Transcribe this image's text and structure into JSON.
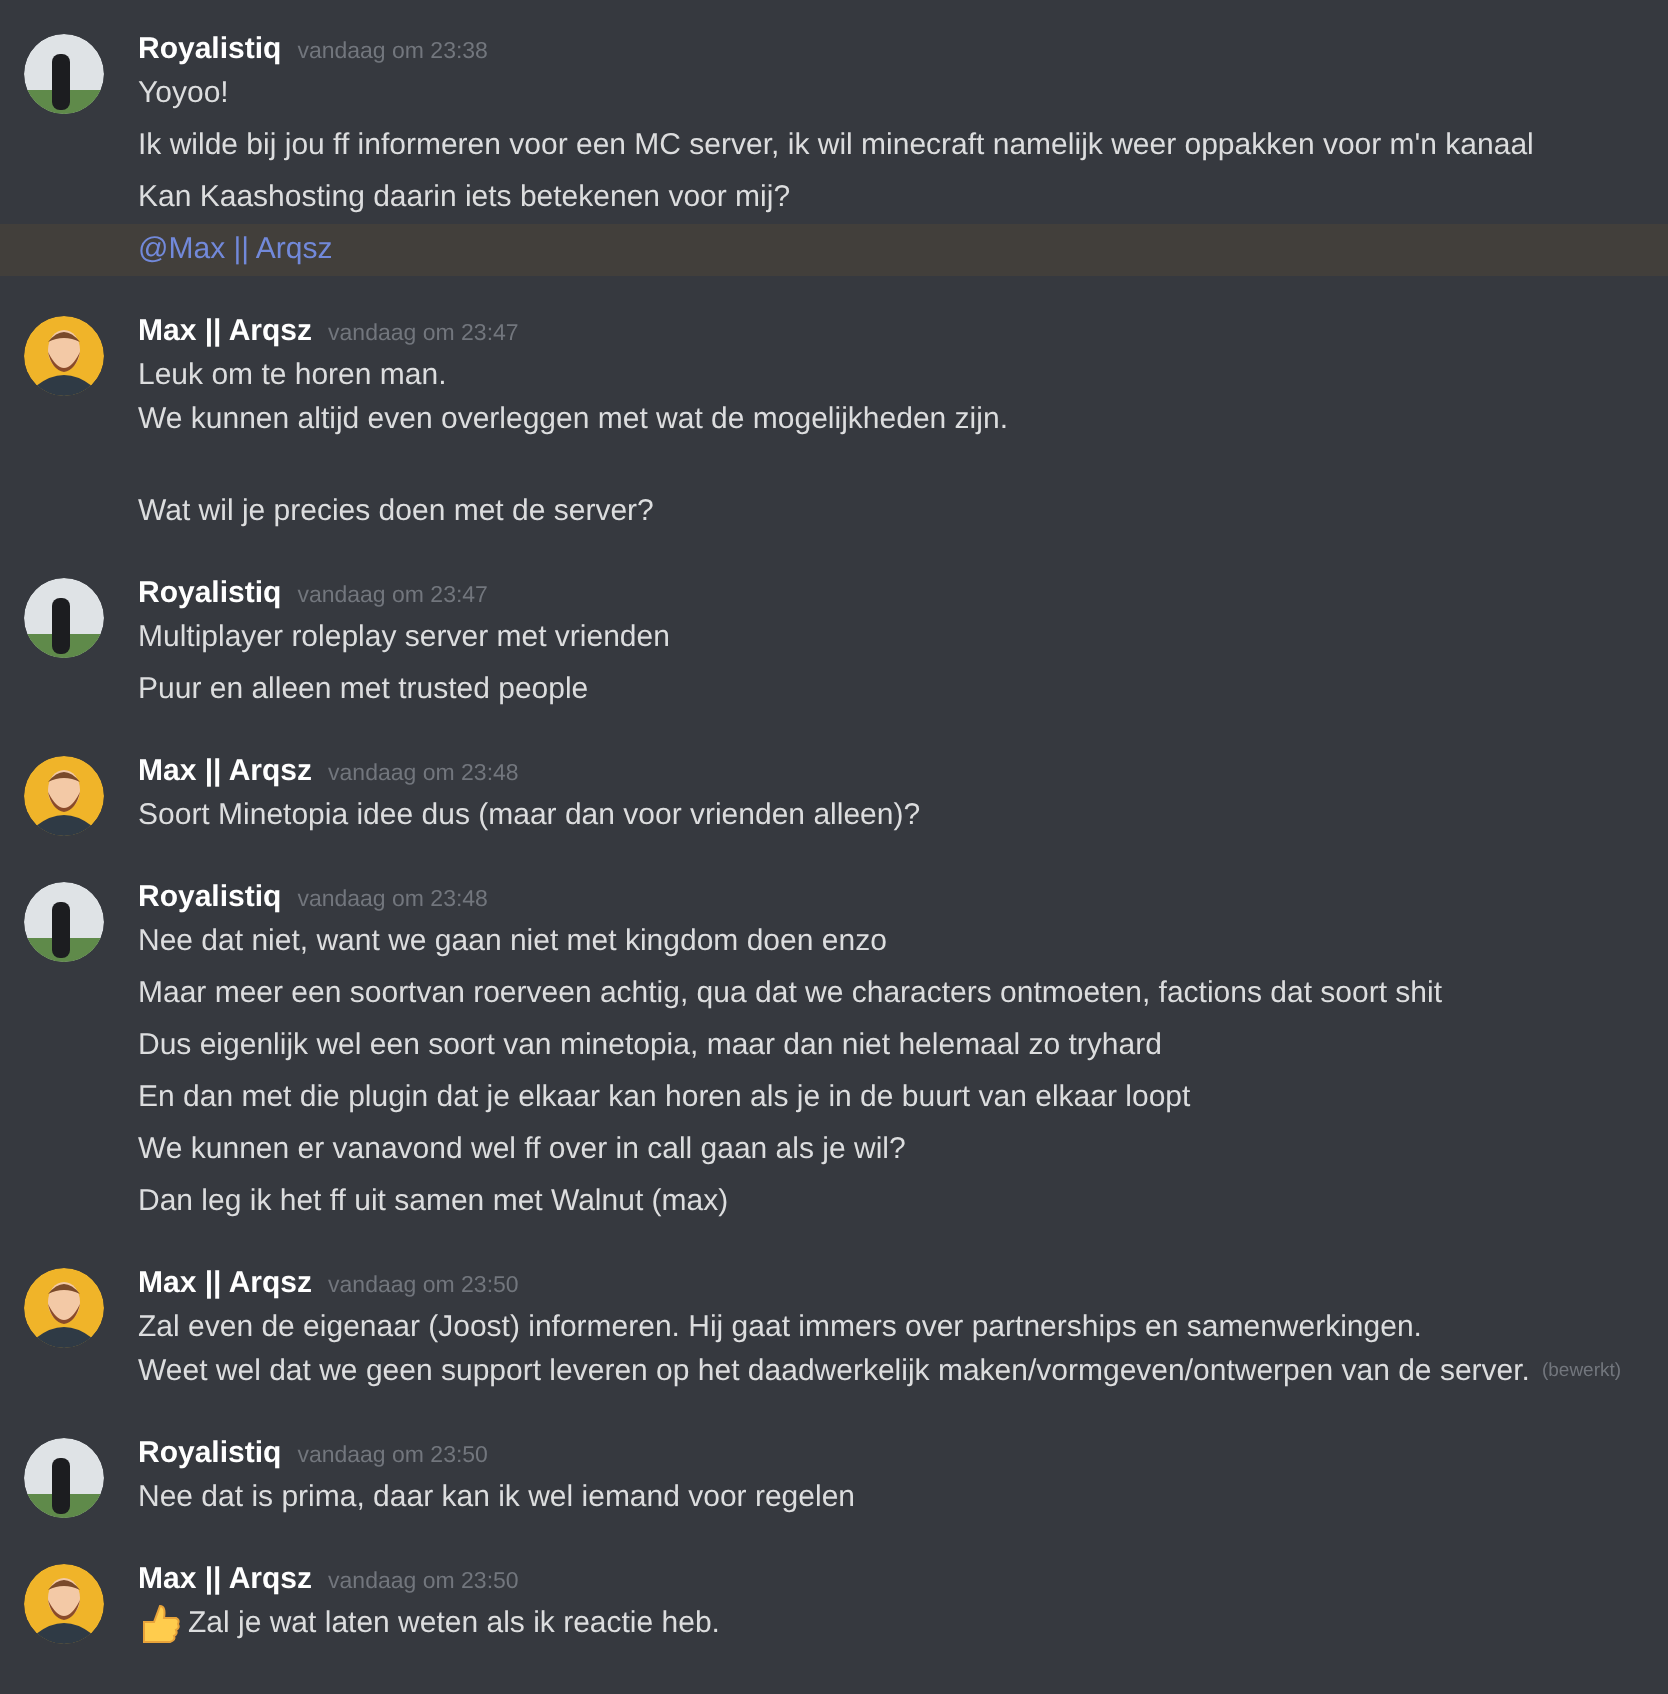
{
  "messages": [
    {
      "author": "Royalistiq",
      "kind": "photo",
      "timestamp": "vandaag om 23:38",
      "messages": [
        {
          "kind": "text",
          "lines": [
            "Yoyoo!"
          ]
        },
        {
          "kind": "text",
          "lines": [
            "Ik wilde bij jou ff informeren voor een MC server, ik wil minecraft namelijk weer oppakken voor m'n kanaal"
          ]
        },
        {
          "kind": "text",
          "lines": [
            "Kan Kaashosting daarin iets betekenen voor mij?"
          ]
        },
        {
          "kind": "mention",
          "lines": [
            "@Max || Arqsz"
          ]
        }
      ]
    },
    {
      "author": "Max || Arqsz",
      "kind": "cartoon",
      "timestamp": "vandaag om 23:47",
      "messages": [
        {
          "kind": "text",
          "lines": [
            "Leuk om te horen man.",
            "We kunnen altijd even overleggen met wat de mogelijkheden zijn."
          ]
        },
        {
          "kind": "paragraph",
          "lines": [
            "Wat wil je precies doen met de server?"
          ]
        }
      ]
    },
    {
      "author": "Royalistiq",
      "kind": "photo",
      "timestamp": "vandaag om 23:47",
      "messages": [
        {
          "kind": "text",
          "lines": [
            "Multiplayer roleplay server met vrienden"
          ]
        },
        {
          "kind": "text",
          "lines": [
            "Puur en alleen met trusted people"
          ]
        }
      ]
    },
    {
      "author": "Max || Arqsz",
      "kind": "cartoon",
      "timestamp": "vandaag om 23:48",
      "messages": [
        {
          "kind": "text",
          "lines": [
            "Soort Minetopia idee dus (maar dan voor vrienden alleen)?"
          ]
        }
      ]
    },
    {
      "author": "Royalistiq",
      "kind": "photo",
      "timestamp": "vandaag om 23:48",
      "messages": [
        {
          "kind": "text",
          "lines": [
            "Nee dat niet, want we gaan niet met kingdom doen enzo"
          ]
        },
        {
          "kind": "text",
          "lines": [
            "Maar meer een soortvan roerveen achtig, qua dat we characters ontmoeten, factions dat soort shit"
          ]
        },
        {
          "kind": "text",
          "lines": [
            "Dus eigenlijk wel een soort van minetopia, maar dan niet helemaal zo tryhard"
          ]
        },
        {
          "kind": "text",
          "lines": [
            "En dan met die plugin dat je elkaar kan horen als je in de buurt van elkaar loopt"
          ]
        },
        {
          "kind": "text",
          "lines": [
            "We kunnen er vanavond wel ff over in call gaan als je wil?"
          ]
        },
        {
          "kind": "text",
          "lines": [
            "Dan leg ik het ff uit samen met Walnut (max)"
          ]
        }
      ]
    },
    {
      "author": "Max || Arqsz",
      "kind": "cartoon",
      "timestamp": "vandaag om 23:50",
      "messages": [
        {
          "kind": "text",
          "lines": [
            "Zal even de eigenaar (Joost) informeren. Hij gaat immers over partnerships en samenwerkingen.",
            "Weet wel dat we geen support leveren op het daadwerkelijk maken/vormgeven/ontwerpen van de server."
          ],
          "edited": "(bewerkt)"
        }
      ]
    },
    {
      "author": "Royalistiq",
      "kind": "photo",
      "timestamp": "vandaag om 23:50",
      "messages": [
        {
          "kind": "text",
          "lines": [
            "Nee dat is prima, daar kan ik wel iemand voor regelen"
          ]
        }
      ]
    },
    {
      "author": "Max || Arqsz",
      "kind": "cartoon",
      "timestamp": "vandaag om 23:50",
      "messages": [
        {
          "kind": "thumbs-up",
          "lines": [
            "Zal je wat laten weten als ik reactie heb."
          ]
        }
      ]
    }
  ]
}
